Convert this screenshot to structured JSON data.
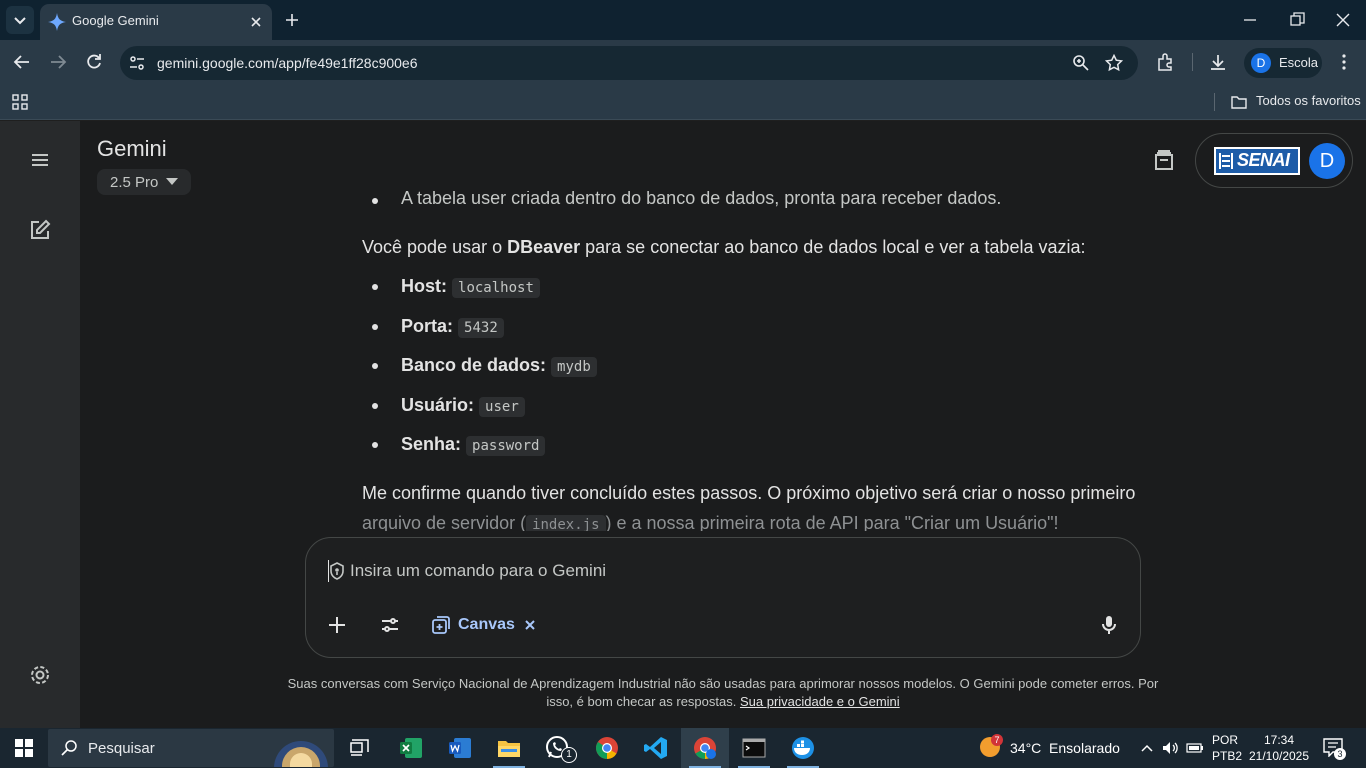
{
  "browser": {
    "tab_title": "Google Gemini",
    "url": "gemini.google.com/app/fe49e1ff28c900e6",
    "profile_initial": "D",
    "profile_label": "Escola",
    "bookmarks_label": "Todos os favoritos"
  },
  "gemini": {
    "title": "Gemini",
    "model": "2.5 Pro",
    "org_logo_text": "SENAI",
    "avatar_initial": "D",
    "content": {
      "partial_bullet": "A tabela user criada dentro do banco de dados, pronta para receber dados.",
      "intro_pre": "Você pode usar o ",
      "intro_bold": "DBeaver",
      "intro_post": " para se conectar ao banco de dados local e ver a tabela vazia:",
      "items": [
        {
          "label": "Host:",
          "value": "localhost"
        },
        {
          "label": "Porta:",
          "value": "5432"
        },
        {
          "label": "Banco de dados:",
          "value": "mydb"
        },
        {
          "label": "Usuário:",
          "value": "user"
        },
        {
          "label": "Senha:",
          "value": "password"
        }
      ],
      "closing_1": "Me confirme quando tiver concluído estes passos. O próximo objetivo será criar o nosso primeiro",
      "closing_2_pre": "arquivo de servidor (",
      "closing_2_code": "index.js",
      "closing_2_post": ") e a nossa primeira rota de API para \"Criar um Usuário\"!"
    },
    "prompt_placeholder": "Insira um comando para o Gemini",
    "canvas_label": "Canvas",
    "disclaimer_1": "Suas conversas com Serviço Nacional de Aprendizagem Industrial não são usadas para aprimorar nossos modelos. O Gemini pode cometer erros. Por",
    "disclaimer_2": "isso, é bom checar as respostas.",
    "privacy_link": "Sua privacidade e o Gemini"
  },
  "taskbar": {
    "search_label": "Pesquisar",
    "weather_badge": "7",
    "weather": "34°C  Ensolarado",
    "lang_1": "POR",
    "lang_2": "PTB2",
    "time": "17:34",
    "date": "21/10/2025",
    "notif_count": "3",
    "whatsapp_count": "1"
  },
  "colors": {
    "accent_blue": "#a8c7fa",
    "avatar_blue": "#1a73e8",
    "senai_blue": "#1d5ca8"
  }
}
